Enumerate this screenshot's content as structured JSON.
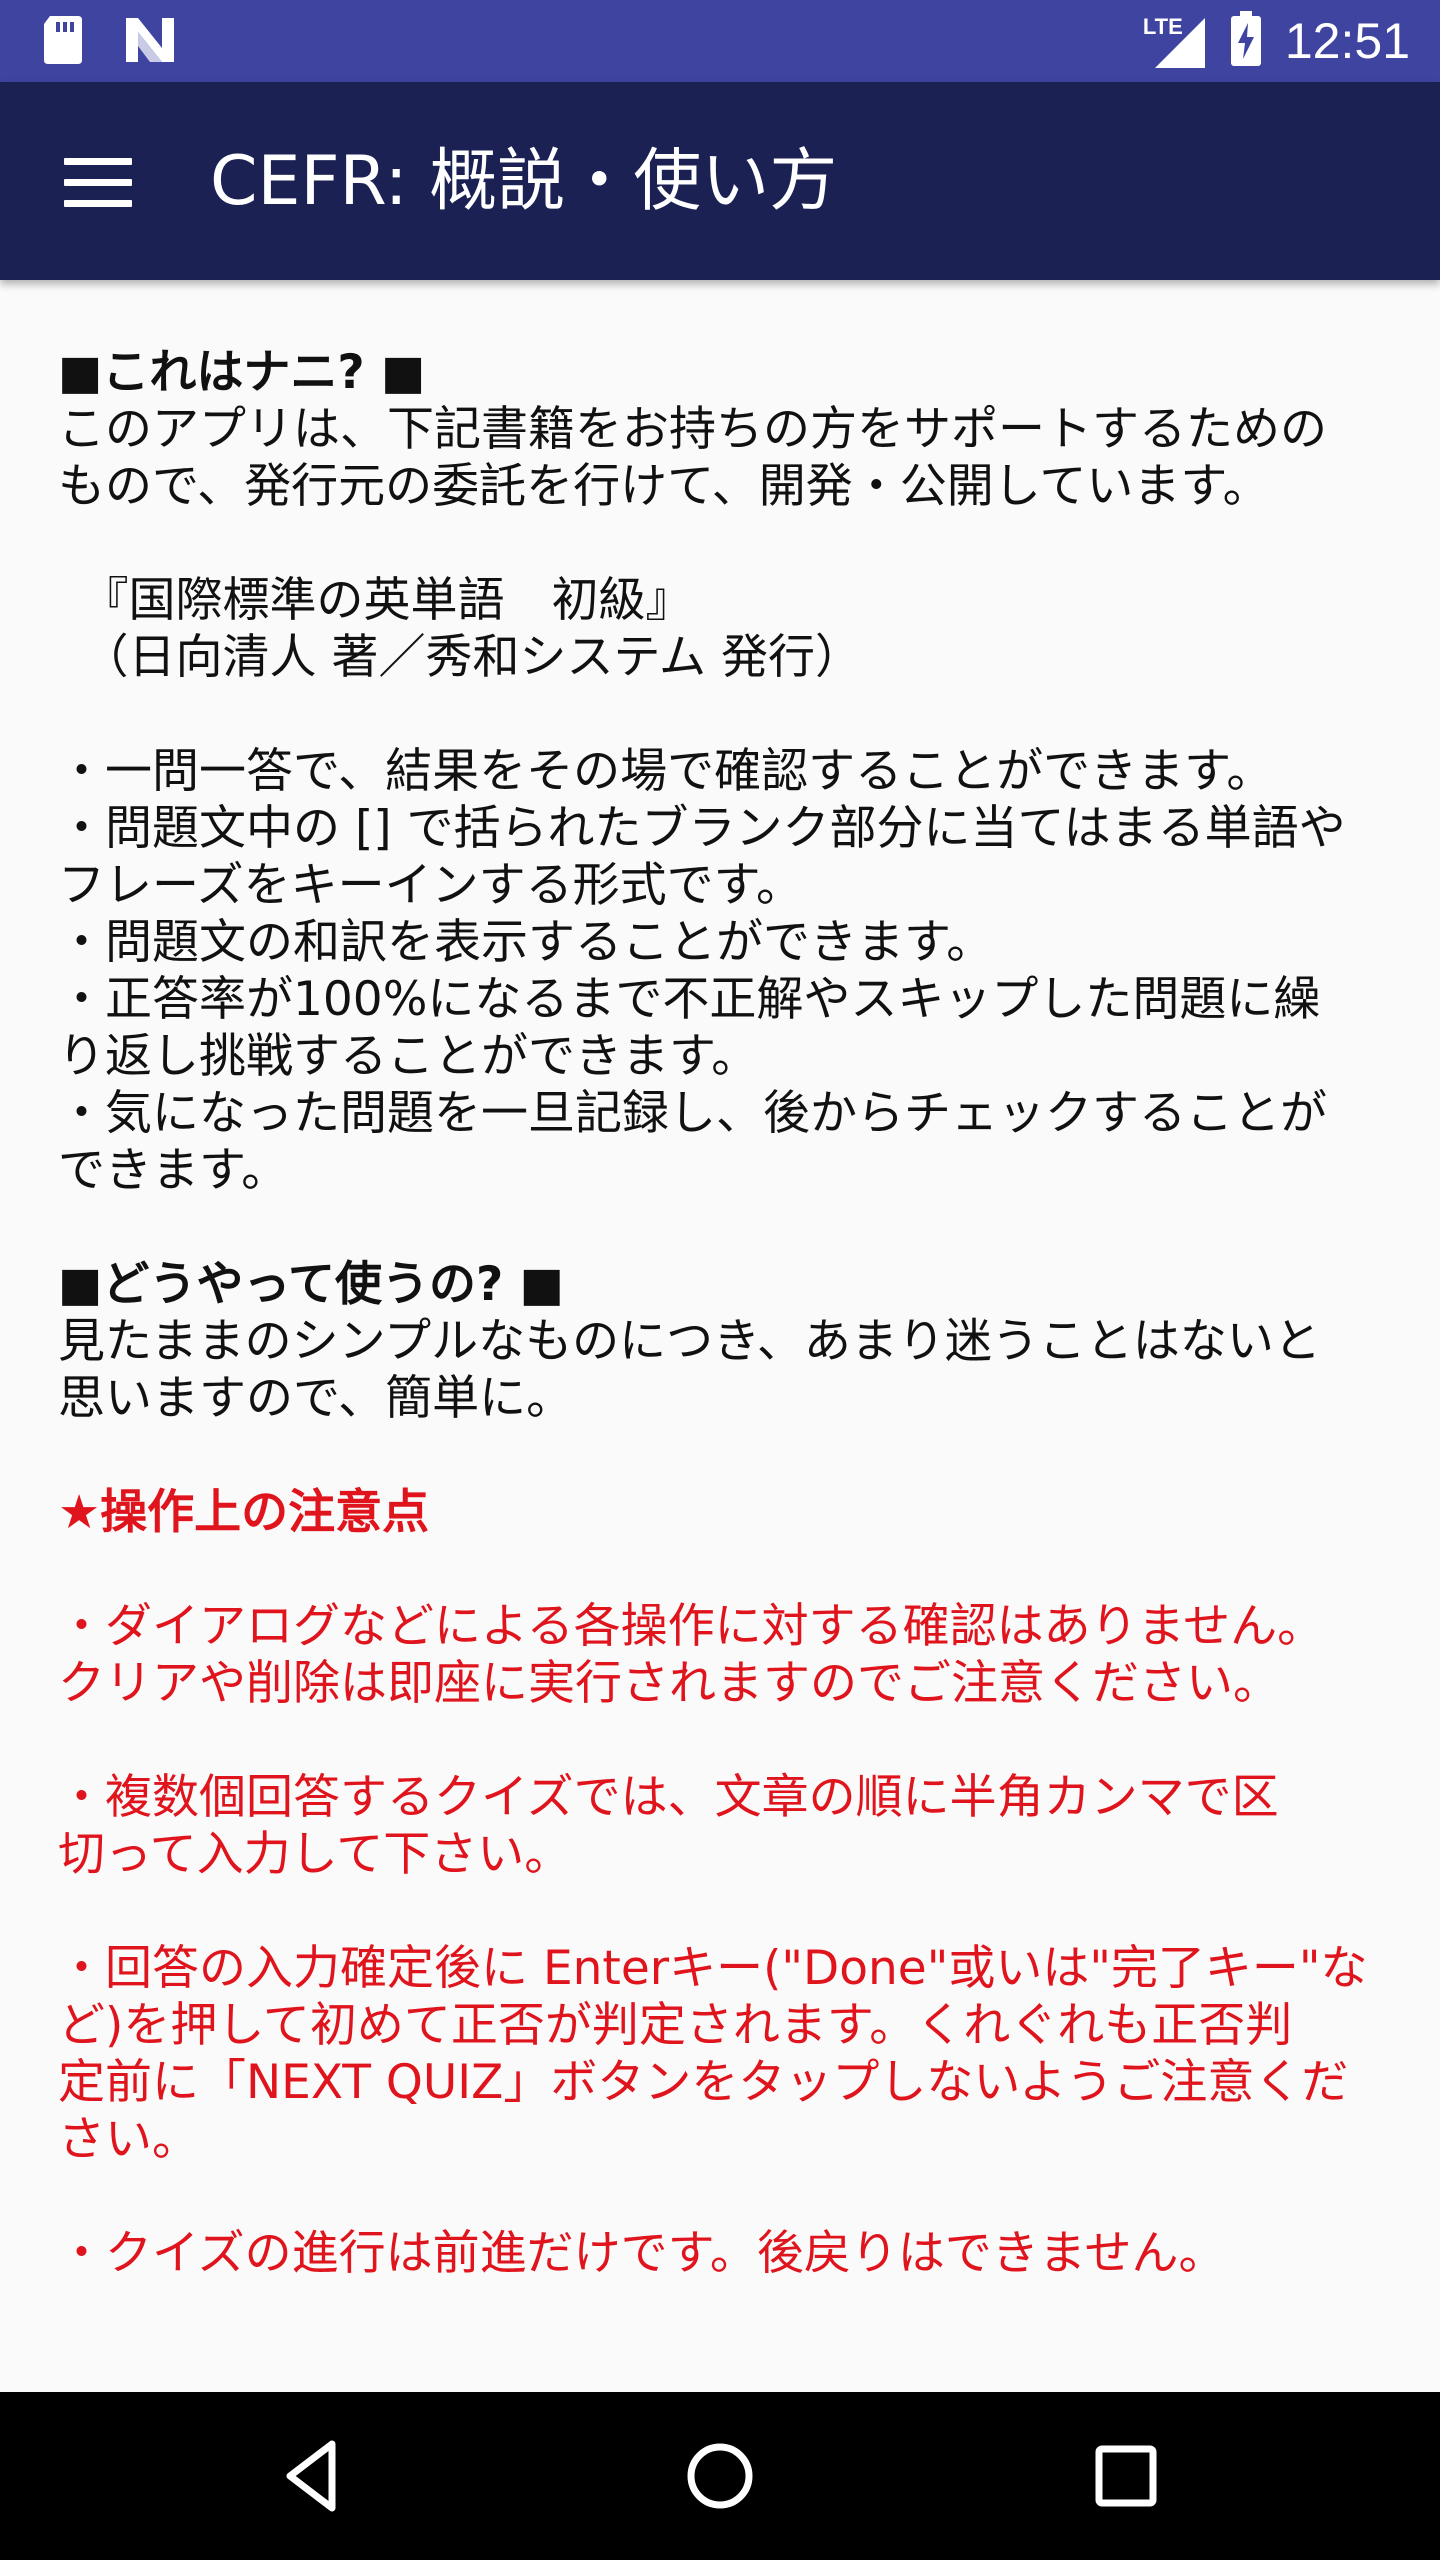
{
  "status_bar": {
    "time": "12:51",
    "network_label": "LTE",
    "icons": [
      "sd-card-icon",
      "n-logo-icon",
      "lte-signal-icon",
      "battery-charging-icon"
    ]
  },
  "app_bar": {
    "title": "CEFR: 概説・使い方",
    "menu_icon": "menu-icon"
  },
  "content": {
    "heading_what": "■これはナニ? ■",
    "intro": "このアプリは、下記書籍をお持ちの方をサポートするための\nもので、発行元の委託を行けて、開発・公開しています。",
    "book_title": "　『国際標準の英単語　初級』",
    "book_author": "　（日向清人 著／秀和システム 発行）",
    "features": [
      "・一問一答で、結果をその場で確認することができます。",
      "・問題文中の [] で括られたブランク部分に当てはまる単語や\nフレーズをキーインする形式です。",
      "・問題文の和訳を表示することができます。",
      "・正答率が100%になるまで不正解やスキップした問題に繰\nり返し挑戦することができます。",
      "・気になった問題を一旦記録し、後からチェックすることが\nできます。"
    ],
    "heading_how": "■どうやって使うの? ■",
    "how_text": "見たままのシンプルなものにつき、あまり迷うことはないと\n思いますので、簡単に。",
    "notice_heading": "★操作上の注意点",
    "notices": [
      "・ダイアログなどによる各操作に対する確認はありません。\nクリアや削除は即座に実行されますのでご注意ください。",
      "・複数個回答するクイズでは、文章の順に半角カンマで区\n切って入力して下さい。",
      "・回答の入力確定後に Enterキー(\"Done\"或いは\"完了キー\"な\nど)を押して初めて正否が判定されます。くれぐれも正否判\n定前に「NEXT QUIZ」ボタンをタップしないようご注意くだ\nさい。",
      "・クイズの進行は前進だけです。後戻りはできません。"
    ]
  },
  "nav_bar": {
    "icons": [
      "back-icon",
      "home-icon",
      "recent-apps-icon"
    ]
  },
  "colors": {
    "status_bar": "#3f44a0",
    "app_bar": "#1c2154",
    "notice_red": "#e0141c",
    "background": "#fafafa"
  }
}
